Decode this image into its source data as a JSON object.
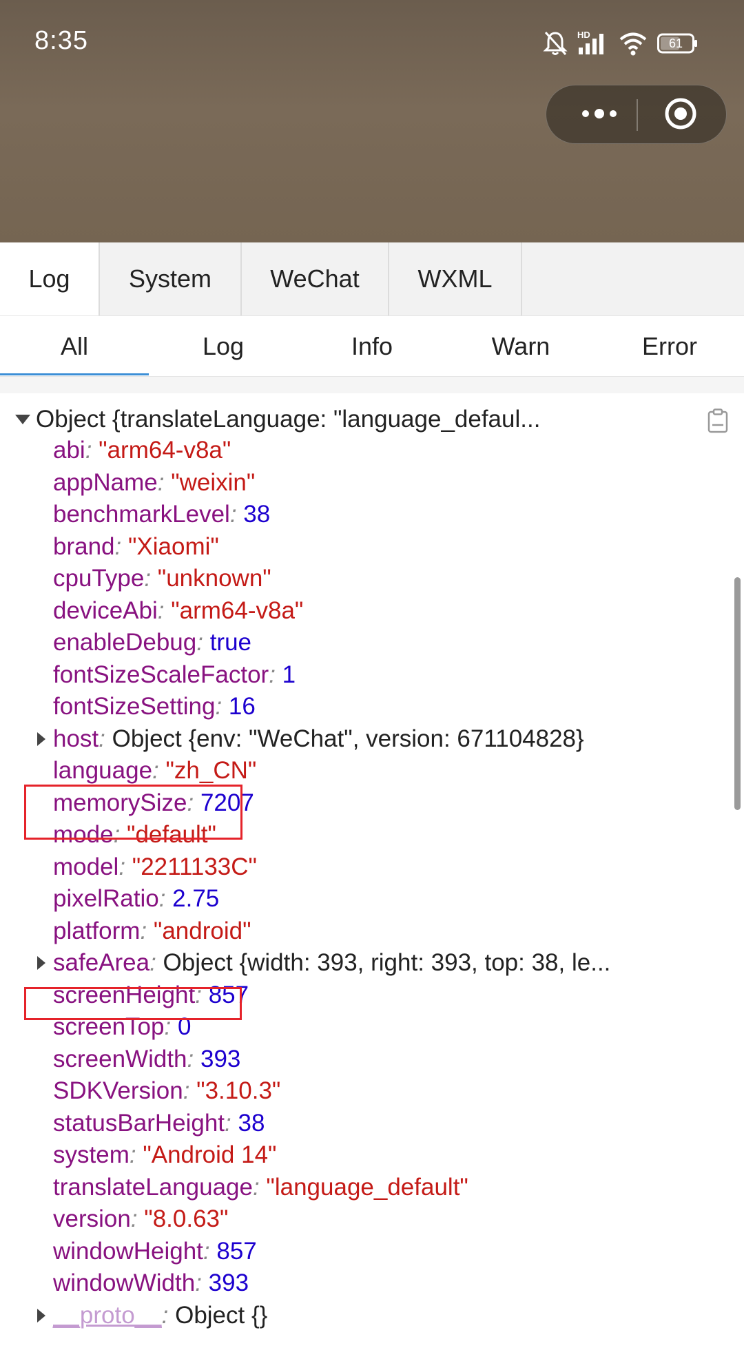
{
  "status_bar": {
    "time": "8:35",
    "network_label": "HD",
    "battery": "61",
    "icons": [
      "bell-off-icon",
      "signal-icon",
      "wifi-icon",
      "battery-icon"
    ]
  },
  "capsule": {
    "more_icon": "more-dots-icon",
    "close_icon": "circle-record-icon"
  },
  "tabs": [
    {
      "label": "Log",
      "active": true
    },
    {
      "label": "System",
      "active": false
    },
    {
      "label": "WeChat",
      "active": false
    },
    {
      "label": "WXML",
      "active": false
    }
  ],
  "filters": [
    {
      "label": "All",
      "active": true
    },
    {
      "label": "Log",
      "active": false
    },
    {
      "label": "Info",
      "active": false
    },
    {
      "label": "Warn",
      "active": false
    },
    {
      "label": "Error",
      "active": false
    }
  ],
  "console": {
    "object_header": "Object {translateLanguage: \"language_defaul...",
    "copy_icon": "clipboard-icon",
    "props": [
      {
        "key": "abi",
        "value": "\"arm64-v8a\"",
        "type": "str"
      },
      {
        "key": "appName",
        "value": "\"weixin\"",
        "type": "str"
      },
      {
        "key": "benchmarkLevel",
        "value": "38",
        "type": "num"
      },
      {
        "key": "brand",
        "value": "\"Xiaomi\"",
        "type": "str"
      },
      {
        "key": "cpuType",
        "value": "\"unknown\"",
        "type": "str"
      },
      {
        "key": "deviceAbi",
        "value": "\"arm64-v8a\"",
        "type": "str"
      },
      {
        "key": "enableDebug",
        "value": "true",
        "type": "bool"
      },
      {
        "key": "fontSizeScaleFactor",
        "value": "1",
        "type": "num"
      },
      {
        "key": "fontSizeSetting",
        "value": "16",
        "type": "num"
      },
      {
        "key": "host",
        "value": "Object {env: \"WeChat\", version: 671104828}",
        "type": "obj",
        "expandable": true
      },
      {
        "key": "language",
        "value": "\"zh_CN\"",
        "type": "str"
      },
      {
        "key": "memorySize",
        "value": "7207",
        "type": "num"
      },
      {
        "key": "mode",
        "value": "\"default\"",
        "type": "str"
      },
      {
        "key": "model",
        "value": "\"2211133C\"",
        "type": "str"
      },
      {
        "key": "pixelRatio",
        "value": "2.75",
        "type": "num"
      },
      {
        "key": "platform",
        "value": "\"android\"",
        "type": "str"
      },
      {
        "key": "safeArea",
        "value": "Object {width: 393, right: 393, top: 38, le...",
        "type": "obj",
        "expandable": true
      },
      {
        "key": "screenHeight",
        "value": "857",
        "type": "num",
        "highlighted": true
      },
      {
        "key": "screenTop",
        "value": "0",
        "type": "num",
        "highlighted": true
      },
      {
        "key": "screenWidth",
        "value": "393",
        "type": "num"
      },
      {
        "key": "SDKVersion",
        "value": "\"3.10.3\"",
        "type": "str"
      },
      {
        "key": "statusBarHeight",
        "value": "38",
        "type": "num"
      },
      {
        "key": "system",
        "value": "\"Android 14\"",
        "type": "str"
      },
      {
        "key": "translateLanguage",
        "value": "\"language_default\"",
        "type": "str"
      },
      {
        "key": "version",
        "value": "\"8.0.63\"",
        "type": "str"
      },
      {
        "key": "windowHeight",
        "value": "857",
        "type": "num",
        "highlighted": true
      },
      {
        "key": "windowWidth",
        "value": "393",
        "type": "num"
      },
      {
        "key": "__proto__",
        "value": "Object {}",
        "type": "obj",
        "expandable": true,
        "proto": true
      }
    ]
  },
  "colors": {
    "accent": "#3c8fd6",
    "highlight": "#e5232a",
    "key": "#881280",
    "string": "#c41a16",
    "number": "#1c00cf"
  }
}
